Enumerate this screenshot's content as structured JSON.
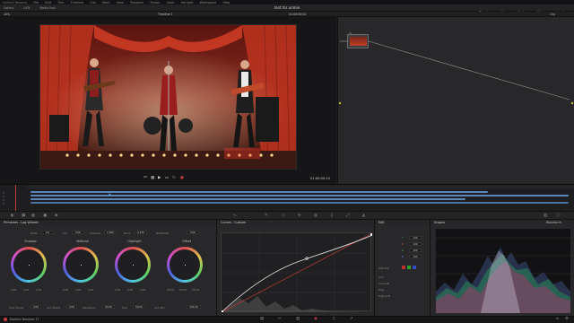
{
  "menubar": {
    "app": "DaVinci Resolve",
    "items": [
      "File",
      "Edit",
      "Trim",
      "Timeline",
      "Clip",
      "Mark",
      "View",
      "Playback",
      "Fusion",
      "Color",
      "Fairlight",
      "Workspace",
      "Help"
    ]
  },
  "header": {
    "project_title": "test for unmie",
    "left_tools": [
      "Gallery",
      "LUTs",
      "Media Pool"
    ],
    "right_tools": [
      "Timeline",
      "Clips",
      "Nodes",
      "Effects",
      "Lightbox"
    ]
  },
  "viewer": {
    "zoom": "46%",
    "timeline_name": "Timeline 1",
    "timecode_top": "01:00:00:02",
    "timecode": "01:00:00:15",
    "clip_label": "Clip"
  },
  "nodes": {
    "node_label": "01"
  },
  "primaries": {
    "title": "Primaries - Log Wheels",
    "row1": [
      {
        "label": "Temp",
        "value": "0.0"
      },
      {
        "label": "Tint",
        "value": "0.00"
      },
      {
        "label": "Contrast",
        "value": "1.000"
      },
      {
        "label": "Pivot",
        "value": "0.435"
      },
      {
        "label": "Mid/Detail",
        "value": "0.00"
      }
    ],
    "wheels": [
      {
        "name": "Shadow",
        "values": [
          "0.00",
          "0.00",
          "0.00"
        ]
      },
      {
        "name": "Midtone",
        "values": [
          "0.00",
          "0.00",
          "0.00"
        ]
      },
      {
        "name": "Highlight",
        "values": [
          "0.00",
          "0.00",
          "0.00"
        ]
      },
      {
        "name": "Offset",
        "values": [
          "25.00",
          "25.00",
          "25.00"
        ]
      }
    ],
    "row2": [
      {
        "label": "Color Boost",
        "value": "0.00"
      },
      {
        "label": "Lum Boost",
        "value": "0.00"
      },
      {
        "label": "Saturation",
        "value": "50.00"
      },
      {
        "label": "Hue",
        "value": "50.00"
      },
      {
        "label": "Lum Mix",
        "value": "100.00"
      }
    ]
  },
  "curves": {
    "title": "Curves - Custom"
  },
  "edit_panel": {
    "title": "Edit",
    "channels": [
      {
        "label": "Y",
        "value": "100"
      },
      {
        "label": "R",
        "value": "100"
      },
      {
        "label": "G",
        "value": "100"
      },
      {
        "label": "B",
        "value": "100"
      }
    ],
    "soft_clip": "Soft Clip",
    "rows": [
      "Low",
      "Low Soft",
      "High",
      "High Soft"
    ]
  },
  "scopes": {
    "title": "Scopes",
    "mode": "Waveform"
  },
  "status": {
    "app_version": "DaVinci Resolve 17"
  },
  "colors": {
    "accent": "#c63a3a",
    "clip_blue": "#5a86b8",
    "panel": "#28282a"
  }
}
